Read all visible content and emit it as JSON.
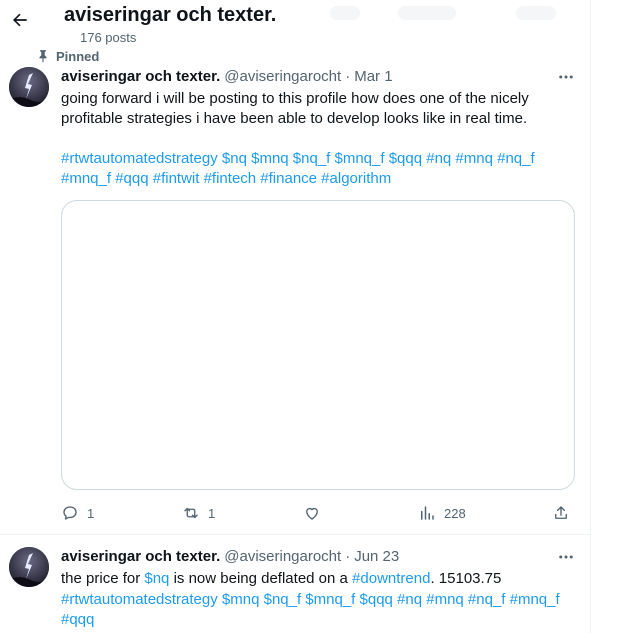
{
  "header": {
    "profile_name": "aviseringar och texter.",
    "post_count": "176 posts"
  },
  "pinned_label": "Pinned",
  "tweets": [
    {
      "author": "aviseringar och texter.",
      "handle": "@aviseringarocht",
      "separator": "·",
      "date": "Mar 1",
      "text": "going forward i will be posting to this profile how does one of the nicely profitable strategies i have been able to develop looks like in real time.",
      "hashtags_line1": "#rtwtautomatedstrategy $nq $mnq $nq_f $mnq_f $qqq #nq #mnq #nq_f",
      "hashtags_line2": "#mnq_f #qqq #fintwit #fintech #finance #algorithm",
      "replies": "1",
      "reposts": "1",
      "views": "228"
    },
    {
      "author": "aviseringar och texter.",
      "handle": "@aviseringarocht",
      "separator": "·",
      "date": "Jun 23",
      "text_part1": "the price for ",
      "cashtag": "$nq",
      "text_part2": " is now being deflated on a ",
      "hashtag": "#downtrend",
      "text_part3": ". 15103.75",
      "hashtags_line1": "#rtwtautomatedstrategy $mnq $nq_f $mnq_f $qqq #nq #mnq #nq_f #mnq_f",
      "hashtags_line2": "#qqq"
    }
  ],
  "colors": {
    "accent": "#1d9bf0",
    "secondary_text": "#536471",
    "primary_text": "#0f1419",
    "border": "#cfd9de"
  }
}
